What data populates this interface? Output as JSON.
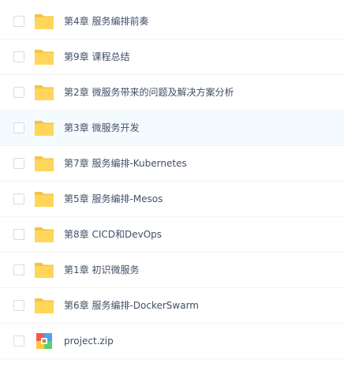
{
  "files": [
    {
      "name": "第4章 服务编排前奏",
      "type": "folder",
      "icon": "folder-icon"
    },
    {
      "name": "第9章 课程总结",
      "type": "folder",
      "icon": "folder-icon"
    },
    {
      "name": "第2章 微服务带来的问题及解决方案分析",
      "type": "folder",
      "icon": "folder-icon"
    },
    {
      "name": "第3章 微服务开发",
      "type": "folder",
      "icon": "folder-icon",
      "hovered": true
    },
    {
      "name": "第7章 服务编排-Kubernetes",
      "type": "folder",
      "icon": "folder-icon"
    },
    {
      "name": "第5章 服务编排-Mesos",
      "type": "folder",
      "icon": "folder-icon"
    },
    {
      "name": "第8章 CICD和DevOps",
      "type": "folder",
      "icon": "folder-icon"
    },
    {
      "name": "第1章 初识微服务",
      "type": "folder",
      "icon": "folder-icon"
    },
    {
      "name": "第6章 服务编排-DockerSwarm",
      "type": "folder",
      "icon": "folder-icon"
    },
    {
      "name": "project.zip",
      "type": "zip",
      "icon": "zip-archive-icon"
    }
  ],
  "colors": {
    "folder_front": "#ffd659",
    "folder_back": "#f7c243",
    "hover_bg": "#f4fbff",
    "text": "#424e67"
  }
}
